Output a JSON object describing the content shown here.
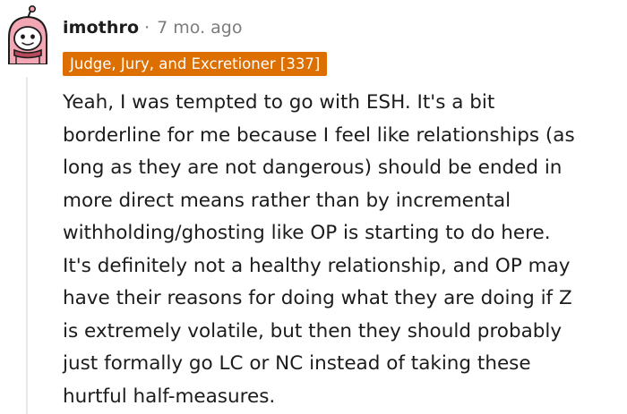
{
  "comment": {
    "author": "imothro",
    "separator": "·",
    "timestamp": "7 mo. ago",
    "flair": "Judge, Jury, and Excretioner [337]",
    "body_lines": [
      "Yeah, I was tempted to go with ESH. It's a bit",
      "borderline for me because I feel like relationships (as",
      "long as they are not dangerous) should be ended in",
      "more direct means rather than by incremental",
      "withholding/ghosting like OP is starting to do here.",
      "It's definitely not a healthy relationship, and OP may",
      "have their reasons for doing what they are doing if Z",
      "is extremely volatile, but then they should probably",
      "just formally go LC or NC instead of taking these",
      "hurtful half-measures."
    ]
  },
  "colors": {
    "flair_background": "#dd6e00",
    "flair_text": "#ffffff",
    "text": "#1c1c1c",
    "muted": "#7c7c7c",
    "avatar_pink": "#f3a7b4",
    "thread_line": "#e8e8e8"
  },
  "icons": {
    "avatar": "snoo-avatar-icon"
  }
}
